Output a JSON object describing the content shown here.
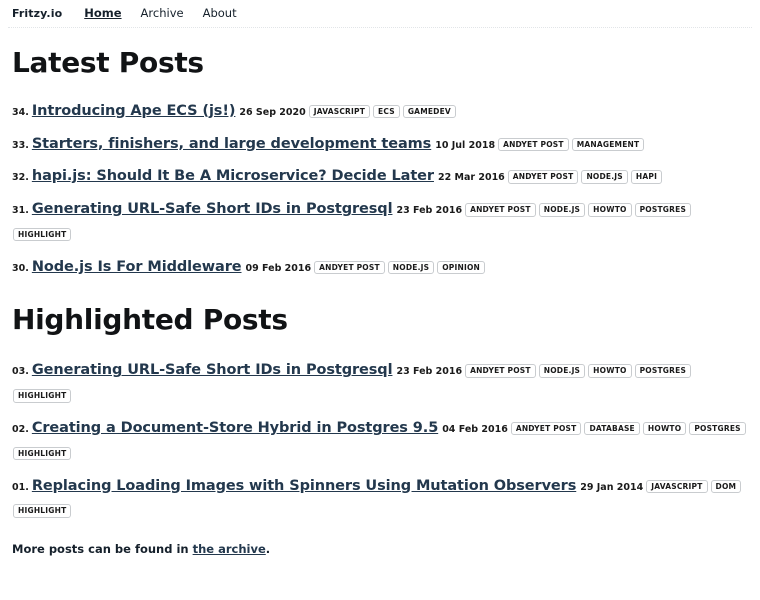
{
  "header": {
    "brand": "Fritzy.io",
    "nav": [
      {
        "label": "Home",
        "active": true
      },
      {
        "label": "Archive",
        "active": false
      },
      {
        "label": "About",
        "active": false
      }
    ]
  },
  "sections": [
    {
      "id": "latest-posts",
      "title": "Latest Posts",
      "posts": [
        {
          "num": "34.",
          "title": "Introducing Ape ECS (js!)",
          "date": "26 Sep 2020",
          "tags": [
            "JAVASCRIPT",
            "ECS",
            "GAMEDEV"
          ]
        },
        {
          "num": "33.",
          "title": "Starters, finishers, and large development teams",
          "date": "10 Jul 2018",
          "tags": [
            "ANDYET POST",
            "MANAGEMENT"
          ]
        },
        {
          "num": "32.",
          "title": "hapi.js: Should It Be A Microservice? Decide Later",
          "date": "22 Mar 2016",
          "tags": [
            "ANDYET POST",
            "NODE.JS",
            "HAPI"
          ]
        },
        {
          "num": "31.",
          "title": "Generating URL-Safe Short IDs in Postgresql",
          "date": "23 Feb 2016",
          "tags": [
            "ANDYET POST",
            "NODE.JS",
            "HOWTO",
            "POSTGRES",
            "HIGHLIGHT"
          ]
        },
        {
          "num": "30.",
          "title": "Node.js Is For Middleware",
          "date": "09 Feb 2016",
          "tags": [
            "ANDYET POST",
            "NODE.JS",
            "OPINION"
          ]
        }
      ]
    },
    {
      "id": "highlighted-posts",
      "title": "Highlighted Posts",
      "posts": [
        {
          "num": "03.",
          "title": "Generating URL-Safe Short IDs in Postgresql",
          "date": "23 Feb 2016",
          "tags": [
            "ANDYET POST",
            "NODE.JS",
            "HOWTO",
            "POSTGRES",
            "HIGHLIGHT"
          ]
        },
        {
          "num": "02.",
          "title": "Creating a Document-Store Hybrid in Postgres 9.5",
          "date": "04 Feb 2016",
          "tags": [
            "ANDYET POST",
            "DATABASE",
            "HOWTO",
            "POSTGRES",
            "HIGHLIGHT"
          ]
        },
        {
          "num": "01.",
          "title": "Replacing Loading Images with Spinners Using Mutation Observers",
          "date": "29 Jan 2014",
          "tags": [
            "JAVASCRIPT",
            "DOM",
            "HIGHLIGHT"
          ]
        }
      ]
    }
  ],
  "footer": {
    "text_before": "More posts can be found in ",
    "link_label": "the archive",
    "text_after": "."
  },
  "colors": {
    "link": "#23384d",
    "heading": "#111315",
    "text": "#1a1a1a",
    "tag_border": "#c9cccf",
    "rule": "#e2e5e8"
  }
}
